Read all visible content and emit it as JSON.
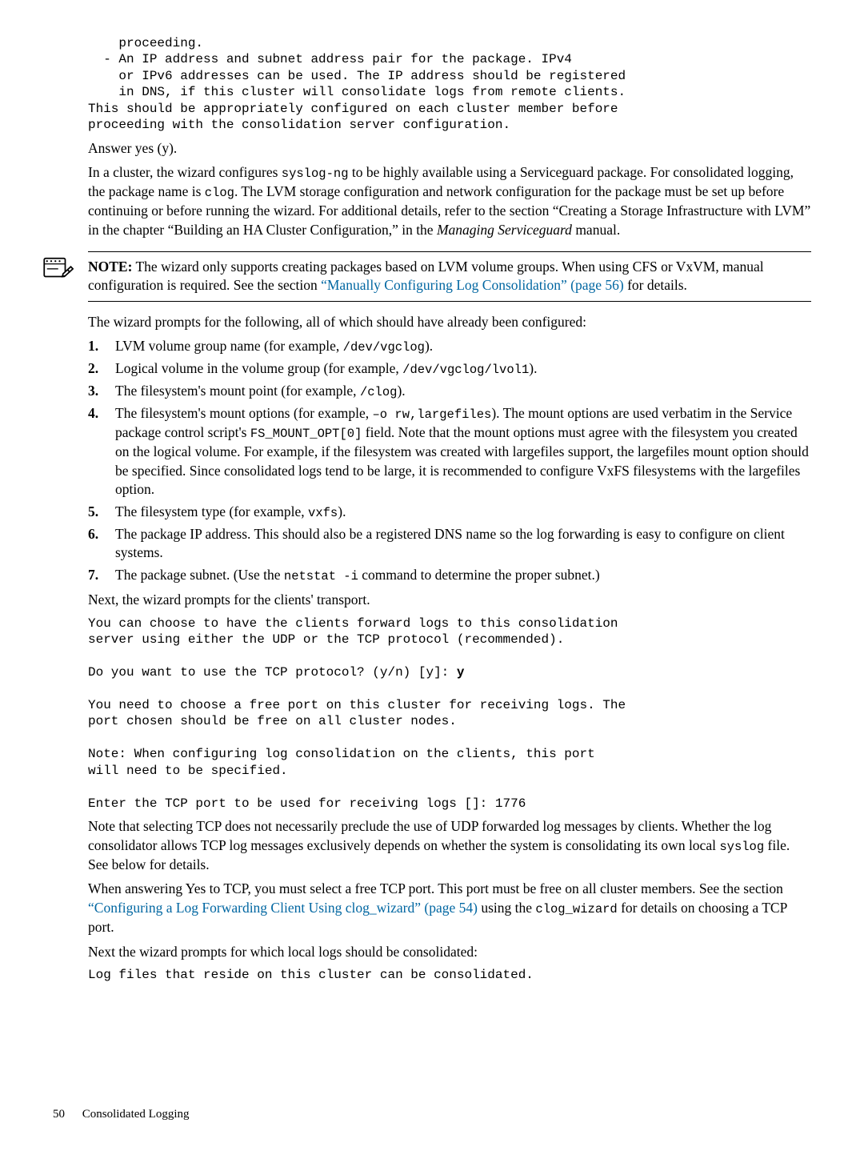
{
  "pre1": "    proceeding.\n  - An IP address and subnet address pair for the package. IPv4\n    or IPv6 addresses can be used. The IP address should be registered\n    in DNS, if this cluster will consolidate logs from remote clients.\nThis should be appropriately configured on each cluster member before\nproceeding with the consolidation server configuration.",
  "answer_yes": "Answer yes (y).",
  "cluster_para_1a": "In a cluster, the wizard configures ",
  "code_syslogng": "syslog-ng",
  "cluster_para_1b": " to be highly available using a Serviceguard package. For consolidated logging, the package name is ",
  "code_clog": "clog",
  "cluster_para_1c": ". The LVM storage configuration and network configuration for the package must be set up before continuing or before running the wizard. For additional details, refer to the section “Creating a Storage Infrastructure with LVM” in the chapter “Building an HA Cluster Configuration,” in the ",
  "msg_ital": "Managing Serviceguard",
  "cluster_para_1d": " manual.",
  "note_label": "NOTE:",
  "note_body_a": "   The wizard only supports creating packages based on LVM volume groups. When using CFS or VxVM, manual configuration is required. See the section ",
  "note_link": "“Manually Configuring Log Consolidation” (page 56)",
  "note_body_b": " for details.",
  "wiz_prompts": "The wizard prompts for the following, all of which should have already been configured:",
  "li": {
    "1": {
      "a": "LVM volume group name (for example, ",
      "c": "/dev/vgclog",
      "b": ")."
    },
    "2": {
      "a": "Logical volume in the volume group (for example, ",
      "c": "/dev/vgclog/lvol1",
      "b": ")."
    },
    "3": {
      "a": "The filesystem's mount point (for example, ",
      "c": "/clog",
      "b": ")."
    },
    "4": {
      "a": "The filesystem's mount options (for example, ",
      "c1": "–o rw,largefiles",
      "b1": "). The mount options are used verbatim in the Service package control script's ",
      "c2": "FS_MOUNT_OPT[0]",
      "b2": " field. Note that the mount options must agree with the filesystem you created on the logical volume. For example, if the filesystem was created with largefiles support, the largefiles mount option should be specified. Since consolidated logs tend to be large, it is recommended to configure VxFS filesystems with the largefiles option."
    },
    "5": {
      "a": "The filesystem type (for example, ",
      "c": "vxfs",
      "b": ")."
    },
    "6": {
      "a": "The package IP address. This should also be a registered DNS name so the log forwarding is easy to configure on client systems."
    },
    "7": {
      "a": "The package subnet. (Use the ",
      "c": "netstat -i",
      "b": " command to determine the proper subnet.)"
    }
  },
  "next_transport": "Next, the wizard prompts for the clients' transport.",
  "pre2": "You can choose to have the clients forward logs to this consolidation\nserver using either the UDP or the TCP protocol (recommended).\n\nDo you want to use the TCP protocol? (y/n) [y]: ",
  "pre2_bold": "y",
  "pre2b": "\n\nYou need to choose a free port on this cluster for receiving logs. The\nport chosen should be free on all cluster nodes.\n\nNote: When configuring log consolidation on the clients, this port\nwill need to be specified.\n\nEnter the TCP port to be used for receiving logs []: 1776",
  "tcp_note_a": "Note that selecting TCP does not necessarily preclude the use of UDP forwarded log messages by clients. Whether the log consolidator allows TCP log messages exclusively depends on whether the system is consolidating its own local ",
  "code_syslog": "syslog",
  "tcp_note_b": " file. See below for details.",
  "yes_tcp_a": "When answering Yes to TCP, you must select a free TCP port. This port must be free on all cluster members. See the section ",
  "yes_tcp_link": "“Configuring a Log Forwarding Client Using clog_wizard” (page 54)",
  "yes_tcp_b": " using the ",
  "code_clog_wizard": "clog_wizard",
  "yes_tcp_c": " for details on choosing a TCP port.",
  "next_local": "Next the wizard prompts for which local logs should be consolidated:",
  "pre3": "Log files that reside on this cluster can be consolidated.",
  "footer_page": "50",
  "footer_title": "Consolidated Logging"
}
